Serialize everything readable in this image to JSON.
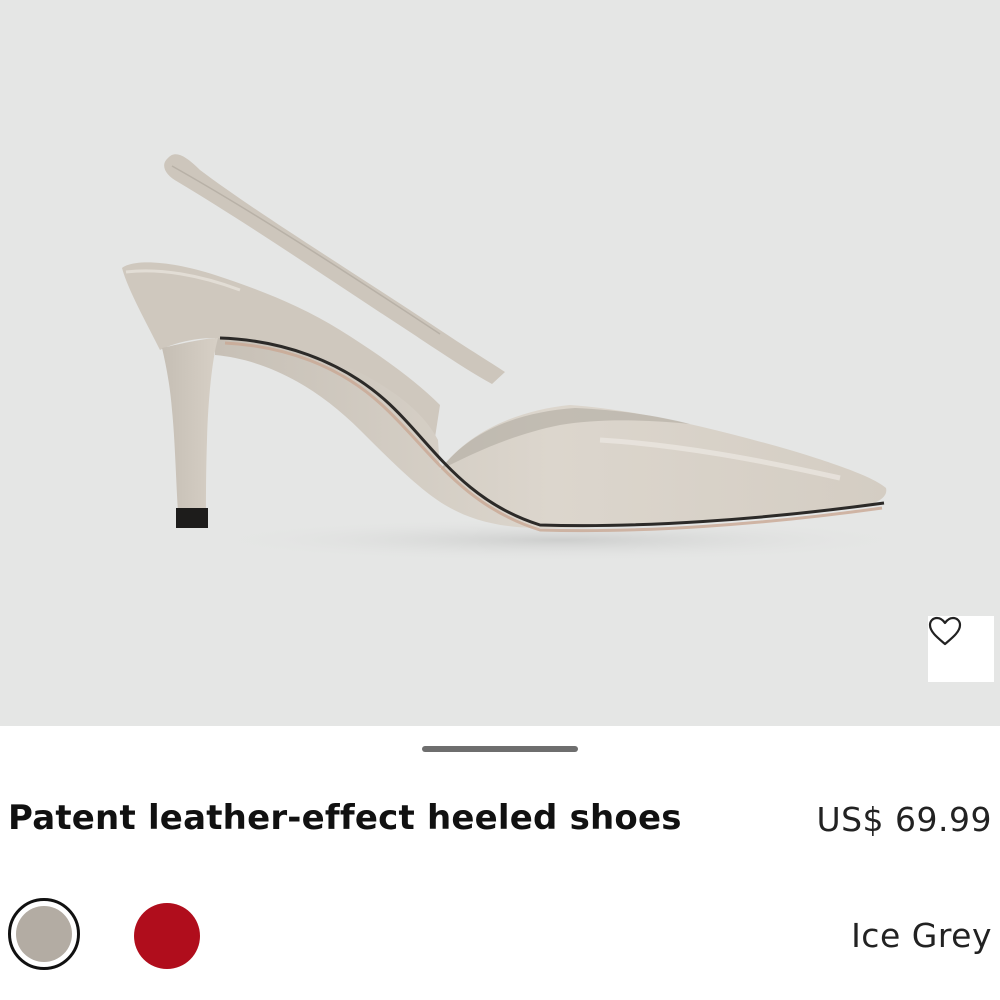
{
  "product": {
    "title": "Patent leather-effect heeled shoes",
    "price": "US$ 69.99",
    "selected_color_name": "Ice Grey",
    "image_alt": "Ice grey patent slingback pointed-toe heeled shoe"
  },
  "colors": {
    "background_image": "#e5e6e5",
    "swatch_ice_grey": "#b3aca3",
    "swatch_red": "#b00d1c",
    "shoe_body": "#d8d2c9"
  },
  "icons": {
    "wishlist": "heart-icon"
  }
}
